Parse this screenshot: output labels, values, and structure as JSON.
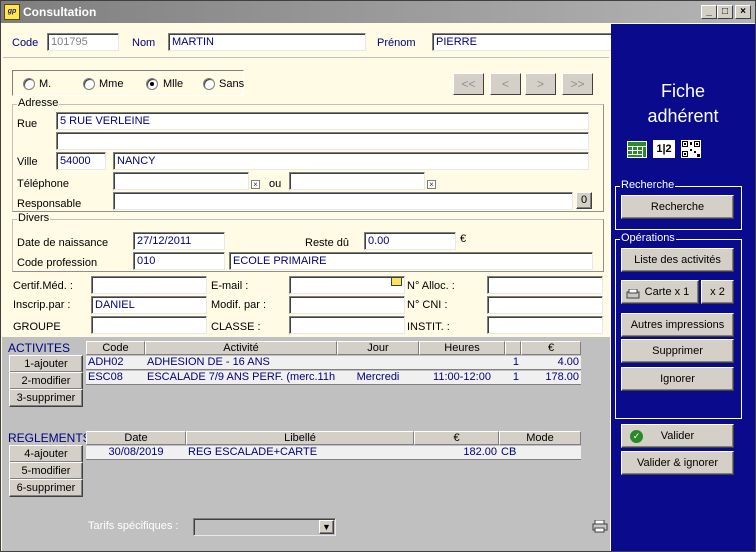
{
  "window": {
    "title": "Consultation",
    "icon": "app-logo"
  },
  "header": {
    "code_label": "Code",
    "code_value": "101795",
    "nom_label": "Nom",
    "nom_value": "MARTIN",
    "prenom_label": "Prénom",
    "prenom_value": "PIERRE"
  },
  "civility": {
    "options": [
      "M.",
      "Mme",
      "Mlle",
      "Sans"
    ],
    "selected": "Mlle"
  },
  "nav": {
    "first": "<<",
    "prev": "<",
    "next": ">",
    "last": ">>"
  },
  "adresse": {
    "group_label": "Adresse",
    "rue_label": "Rue",
    "rue_value": "5 RUE VERLEINE",
    "rue2_value": "",
    "ville_label": "Ville",
    "cp_value": "54000",
    "ville_value": "NANCY",
    "tel_label": "Téléphone",
    "tel_value": "",
    "ou_label": "ou",
    "tel2_value": "",
    "resp_label": "Responsable",
    "resp_value": "",
    "resp_btn": "0"
  },
  "divers": {
    "group_label": "Divers",
    "dob_label": "Date de naissance",
    "dob_value": "27/12/2011",
    "reste_label": "Reste dû",
    "reste_value": "0.00",
    "currency": "€",
    "prof_label": "Code profession",
    "prof_code": "010",
    "prof_value": "ECOLE PRIMAIRE"
  },
  "extra": {
    "certif_label": "Certif.Méd. :",
    "certif_value": "",
    "email_label": "E-mail :",
    "email_value": "",
    "alloc_label": "N° Alloc. :",
    "alloc_value": "",
    "inscrip_label": "Inscrip.par :",
    "inscrip_value": "DANIEL",
    "modif_label": "Modif. par :",
    "modif_value": "",
    "cni_label": "N° CNI :",
    "cni_value": "",
    "groupe_label": "GROUPE",
    "groupe_value": "",
    "classe_label": "CLASSE :",
    "classe_value": "",
    "instit_label": "INSTIT. :",
    "instit_value": ""
  },
  "activites": {
    "title": "ACTIVITES",
    "buttons": {
      "add": "1-ajouter",
      "modify": "2-modifier",
      "delete": "3-supprimer"
    },
    "columns": [
      "Code",
      "Activité",
      "Jour",
      "Heures",
      "",
      "€"
    ],
    "rows": [
      {
        "code": "ADH02",
        "activite": "ADHESION DE - 16 ANS",
        "jour": "",
        "heures": "",
        "qty": "1",
        "prix": "4.00"
      },
      {
        "code": "ESC08",
        "activite": "ESCALADE 7/9 ANS PERF. (merc.11h-",
        "jour": "Mercredi",
        "heures": "11:00-12:00",
        "qty": "1",
        "prix": "178.00"
      }
    ]
  },
  "reglements": {
    "title": "REGLEMENTS",
    "buttons": {
      "add": "4-ajouter",
      "modify": "5-modifier",
      "delete": "6-supprimer"
    },
    "columns": [
      "Date",
      "Libellé",
      "€",
      "Mode"
    ],
    "rows": [
      {
        "date": "30/08/2019",
        "libelle": "REG ESCALADE+CARTE",
        "montant": "182.00",
        "mode": "CB"
      }
    ]
  },
  "tarifs": {
    "label": "Tarifs spécifiques :",
    "value": ""
  },
  "sidebar": {
    "heading_line1": "Fiche",
    "heading_line2": "adhérent",
    "icons": [
      "calculator-icon",
      "numbering-icon",
      "qr-code-icon"
    ],
    "recherche_group": "Recherche",
    "recherche_btn": "Recherche",
    "operations_group": "Opérations",
    "liste_btn": "Liste des activités",
    "carte_btn": "Carte x 1",
    "carte2_btn": "x 2",
    "autres_btn": "Autres impressions",
    "supprimer_btn": "Supprimer",
    "ignorer_btn": "Ignorer",
    "valider_btn": "Valider",
    "valider_ignorer_btn": "Valider & ignorer"
  },
  "colors": {
    "form_bg": "#fffbe4",
    "sidebar_bg": "#0a0a8c",
    "lower_bg": "#c0c0c0",
    "text_blue": "#000080"
  }
}
